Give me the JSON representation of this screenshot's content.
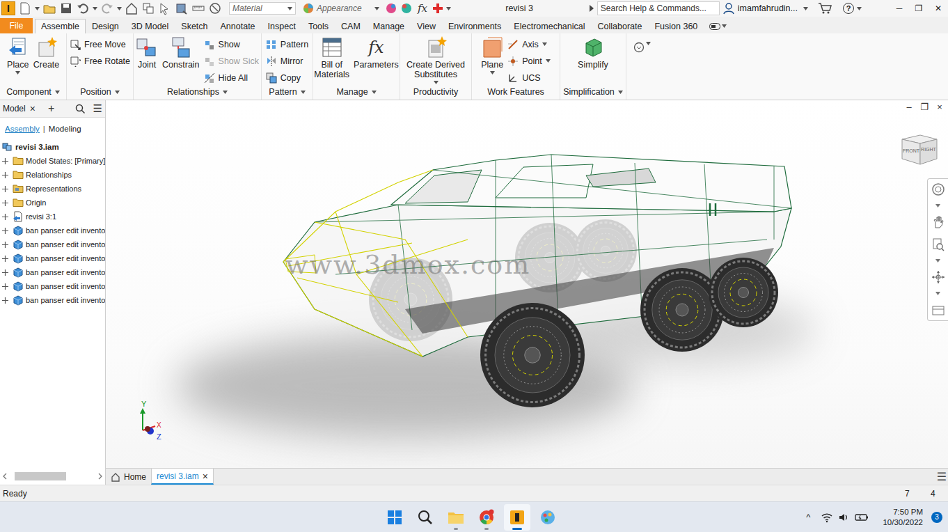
{
  "titlebar": {
    "logo": "I",
    "material": "Material",
    "appearance": "Appearance",
    "fx": "fx",
    "title": "revisi 3",
    "search": {
      "placeholder": "Search Help & Commands..."
    },
    "user": "imamfahrudin...",
    "help": "?",
    "controls": [
      "─",
      "❐",
      "✕"
    ]
  },
  "ribbon_tabs": {
    "file": "File",
    "tabs": [
      {
        "label": "Assemble",
        "selected": true
      },
      {
        "label": "Design",
        "selected": false
      },
      {
        "label": "3D Model",
        "selected": false
      },
      {
        "label": "Sketch",
        "selected": false
      },
      {
        "label": "Annotate",
        "selected": false
      },
      {
        "label": "Inspect",
        "selected": false
      },
      {
        "label": "Tools",
        "selected": false
      },
      {
        "label": "CAM",
        "selected": false
      },
      {
        "label": "Manage",
        "selected": false
      },
      {
        "label": "View",
        "selected": false
      },
      {
        "label": "Environments",
        "selected": false
      },
      {
        "label": "Electromechanical",
        "selected": false
      },
      {
        "label": "Collaborate",
        "selected": false
      },
      {
        "label": "Fusion 360",
        "selected": false
      }
    ]
  },
  "ribbon": {
    "groups": [
      {
        "label": "Component",
        "has_menu": true,
        "items": [
          {
            "label": "Place",
            "kind": "large",
            "dropdown": true,
            "disabled": false
          },
          {
            "label": "Create",
            "kind": "large",
            "dropdown": false,
            "disabled": false
          }
        ]
      },
      {
        "label": "Position",
        "has_menu": true,
        "items": [
          {
            "label": "Free Move",
            "kind": "small",
            "dropdown": false,
            "disabled": false
          },
          {
            "label": "Free Rotate",
            "kind": "small",
            "dropdown": false,
            "disabled": false
          }
        ]
      },
      {
        "label": "Relationships",
        "has_menu": true,
        "items": [
          {
            "label": "Joint",
            "kind": "large",
            "dropdown": false,
            "disabled": false
          },
          {
            "label": "Constrain",
            "kind": "large",
            "dropdown": false,
            "disabled": false
          },
          {
            "label": "Show",
            "kind": "small",
            "dropdown": false,
            "disabled": false
          },
          {
            "label": "Show Sick",
            "kind": "small",
            "dropdown": false,
            "disabled": true
          },
          {
            "label": "Hide All",
            "kind": "small",
            "dropdown": false,
            "disabled": false
          }
        ]
      },
      {
        "label": "Pattern",
        "has_menu": true,
        "items": [
          {
            "label": "Pattern",
            "kind": "small",
            "dropdown": false,
            "disabled": false
          },
          {
            "label": "Mirror",
            "kind": "small",
            "dropdown": false,
            "disabled": false
          },
          {
            "label": "Copy",
            "kind": "small",
            "dropdown": false,
            "disabled": false
          }
        ]
      },
      {
        "label": "Manage",
        "has_menu": true,
        "items": [
          {
            "label": "Bill of Materials",
            "kind": "large",
            "dropdown": false,
            "disabled": false
          },
          {
            "label": "Parameters",
            "kind": "large",
            "dropdown": false,
            "disabled": false,
            "glyph": "fx"
          }
        ]
      },
      {
        "label": "Productivity",
        "has_menu": false,
        "items": [
          {
            "label": "Create Derived Substitutes",
            "kind": "large",
            "dropdown": true,
            "disabled": false
          }
        ]
      },
      {
        "label": "Work Features",
        "has_menu": false,
        "items": [
          {
            "label": "Plane",
            "kind": "large",
            "dropdown": true,
            "disabled": false
          },
          {
            "label": "Axis",
            "kind": "small",
            "dropdown": true,
            "disabled": false
          },
          {
            "label": "Point",
            "kind": "small",
            "dropdown": true,
            "disabled": false
          },
          {
            "label": "UCS",
            "kind": "small",
            "dropdown": false,
            "disabled": false
          }
        ]
      },
      {
        "label": "Simplification",
        "has_menu": true,
        "items": [
          {
            "label": "Simplify",
            "kind": "large",
            "dropdown": false,
            "disabled": false
          }
        ]
      }
    ]
  },
  "browser": {
    "title": "Model",
    "close": "×",
    "add": "+",
    "menu": "☰",
    "separator": "|",
    "modes": [
      {
        "label": "Assembly",
        "selected": true
      },
      {
        "label": "Modeling",
        "selected": false
      }
    ],
    "tree": [
      {
        "label": "revisi 3.iam",
        "kind": "root",
        "expandable": false,
        "expanded": true
      },
      {
        "label": "Model States: [Primary]",
        "kind": "folder",
        "expandable": true,
        "expanded": false
      },
      {
        "label": "Relationships",
        "kind": "folder",
        "expandable": true,
        "expanded": false
      },
      {
        "label": "Representations",
        "kind": "representations",
        "expandable": true,
        "expanded": false
      },
      {
        "label": "Origin",
        "kind": "folder",
        "expandable": true,
        "expanded": false
      },
      {
        "label": "revisi 3:1",
        "kind": "subassembly",
        "expandable": true,
        "expanded": false
      },
      {
        "label": "ban panser edit invento",
        "kind": "part",
        "expandable": true,
        "expanded": false
      },
      {
        "label": "ban panser edit invento",
        "kind": "part",
        "expandable": true,
        "expanded": false
      },
      {
        "label": "ban panser edit invento",
        "kind": "part",
        "expandable": true,
        "expanded": false
      },
      {
        "label": "ban panser edit invento",
        "kind": "part",
        "expandable": true,
        "expanded": false
      },
      {
        "label": "ban panser edit invento",
        "kind": "part",
        "expandable": true,
        "expanded": false
      },
      {
        "label": "ban panser edit invento",
        "kind": "part",
        "expandable": true,
        "expanded": false
      }
    ]
  },
  "viewport": {
    "watermark": "www.3dmox.com",
    "viewcube": {
      "front": "FRONT",
      "right": "RIGHT"
    },
    "triad": {
      "y": "Y",
      "x": "X",
      "z": "Z"
    },
    "controls": [
      "–",
      "❐",
      "×"
    ]
  },
  "doc_tabs": {
    "home": "Home",
    "tabs": [
      {
        "label": "revisi 3.iam",
        "selected": true,
        "close": "×"
      }
    ],
    "menu": "☰"
  },
  "status_bar": {
    "text": "Ready",
    "cells": [
      "7",
      "4"
    ]
  },
  "taskbar": {
    "apps": [
      {
        "running": false,
        "active": false
      },
      {
        "running": false,
        "active": false
      },
      {
        "running": true,
        "active": false
      },
      {
        "running": true,
        "active": false
      },
      {
        "running": true,
        "active": true
      },
      {
        "running": false,
        "active": false
      }
    ]
  },
  "tray": {
    "chevron": "^",
    "time": "7:50 PM",
    "date": "10/30/2022",
    "badge": "3"
  }
}
